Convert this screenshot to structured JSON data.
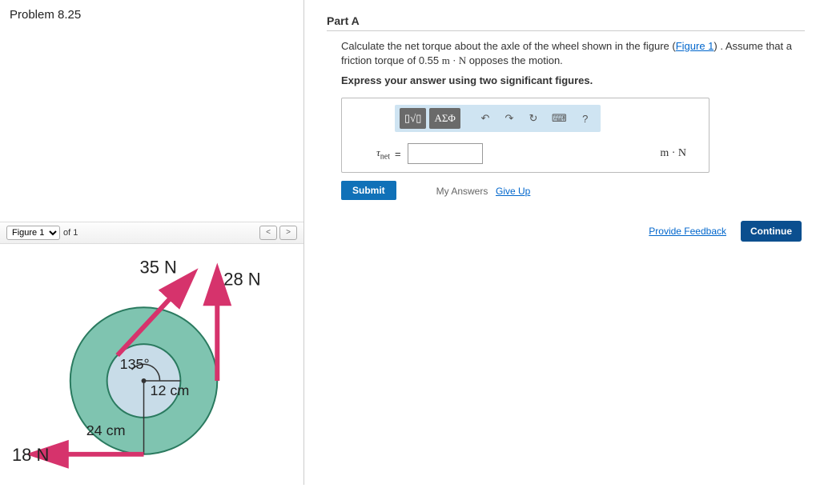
{
  "problem": {
    "title": "Problem 8.25"
  },
  "figureToolbar": {
    "selectLabel": "Figure 1",
    "ofLabel": "of 1",
    "prev": "<",
    "next": ">"
  },
  "figure": {
    "force35": "35 N",
    "force28": "28 N",
    "force18": "18 N",
    "angle": "135°",
    "r_inner": "12 cm",
    "r_outer": "24 cm"
  },
  "part": {
    "title": "Part A",
    "text1": "Calculate the net torque about the axle of the wheel shown in the figure (",
    "figLink": "Figure 1",
    "text2": ") . Assume that a friction torque of 0.55 ",
    "text3": " opposes the motion.",
    "torqueSym": "m · N",
    "instruct": "Express your answer using two significant figures."
  },
  "toolbar": {
    "templates": "▯√▯",
    "greek": "ΑΣΦ",
    "undo": "↶",
    "redo": "↷",
    "reset": "↻",
    "keyboard": "⌨",
    "help": "?"
  },
  "answer": {
    "varName": "τ",
    "varSub": "net",
    "eq": "=",
    "unit": "m · N",
    "value": ""
  },
  "actions": {
    "submit": "Submit",
    "myAnswers": "My Answers",
    "giveUp": "Give Up",
    "feedback": "Provide Feedback",
    "continue": "Continue"
  }
}
